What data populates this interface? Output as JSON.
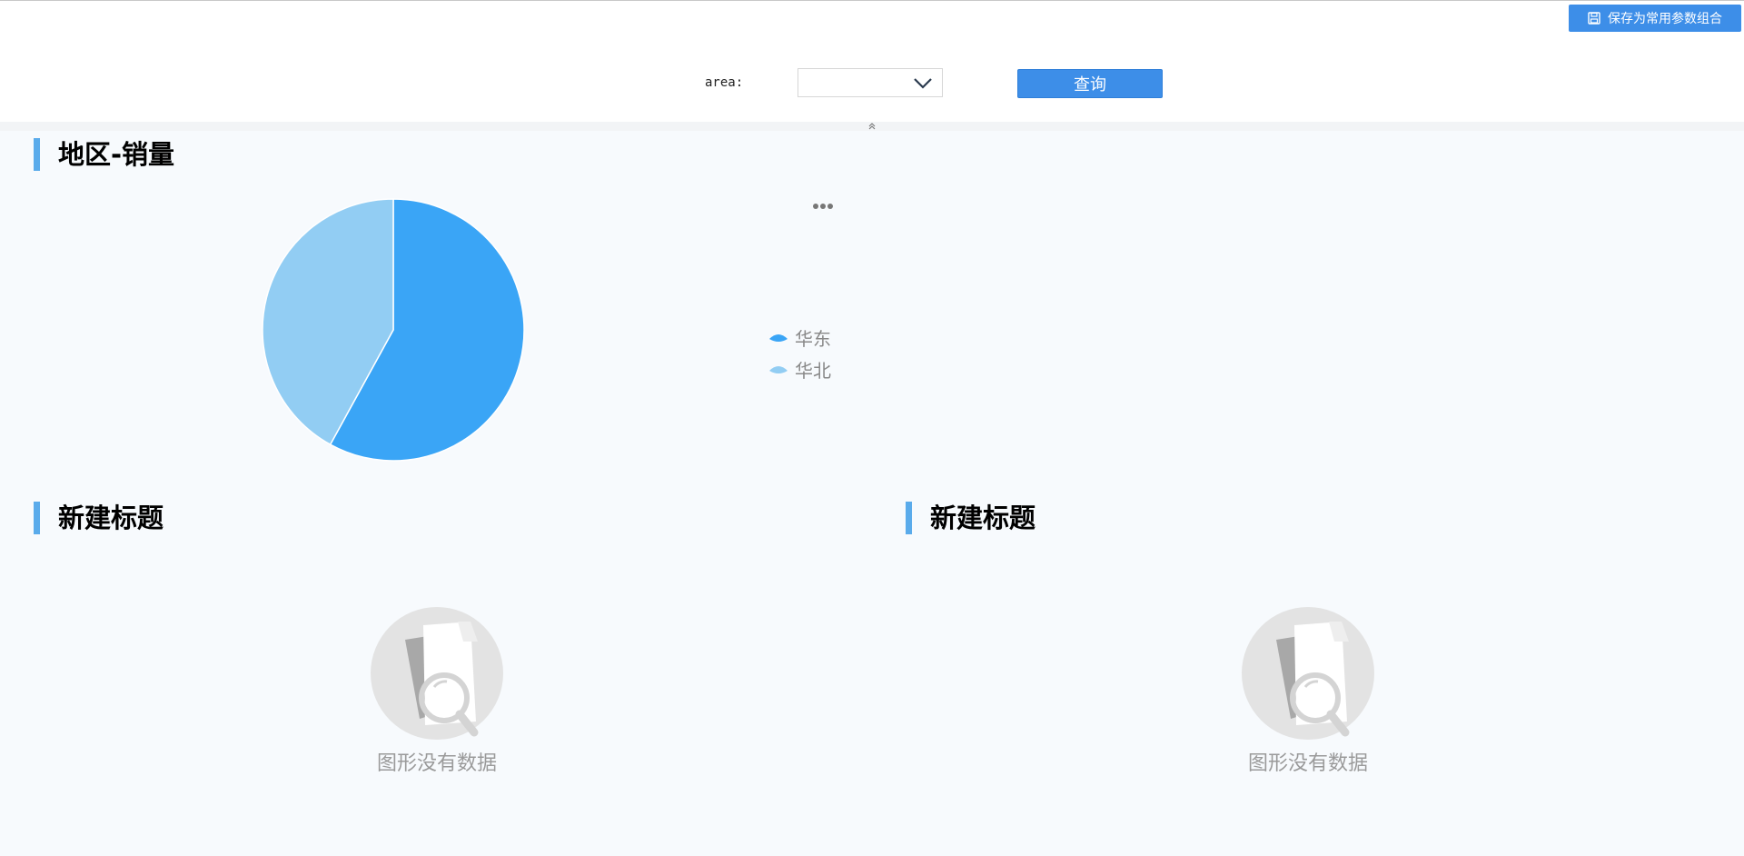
{
  "toolbar": {
    "save_label": "保存为常用参数组合"
  },
  "filter": {
    "area_label": "area:",
    "area_value": "",
    "query_label": "查询"
  },
  "colors": {
    "accent": "#3d8ee8",
    "section_bar": "#5aabeb",
    "series_1": "#3aa5f6",
    "series_2": "#92cdf3"
  },
  "sections": [
    {
      "title": "地区-销量"
    },
    {
      "title": "新建标题",
      "empty_message": "图形没有数据"
    },
    {
      "title": "新建标题",
      "empty_message": "图形没有数据"
    }
  ],
  "chart_data": {
    "type": "pie",
    "title": "",
    "categories": [
      "华东",
      "华北"
    ],
    "values": [
      58,
      42
    ],
    "legend_position": "right",
    "colors": [
      "#3aa5f6",
      "#92cdf3"
    ]
  }
}
